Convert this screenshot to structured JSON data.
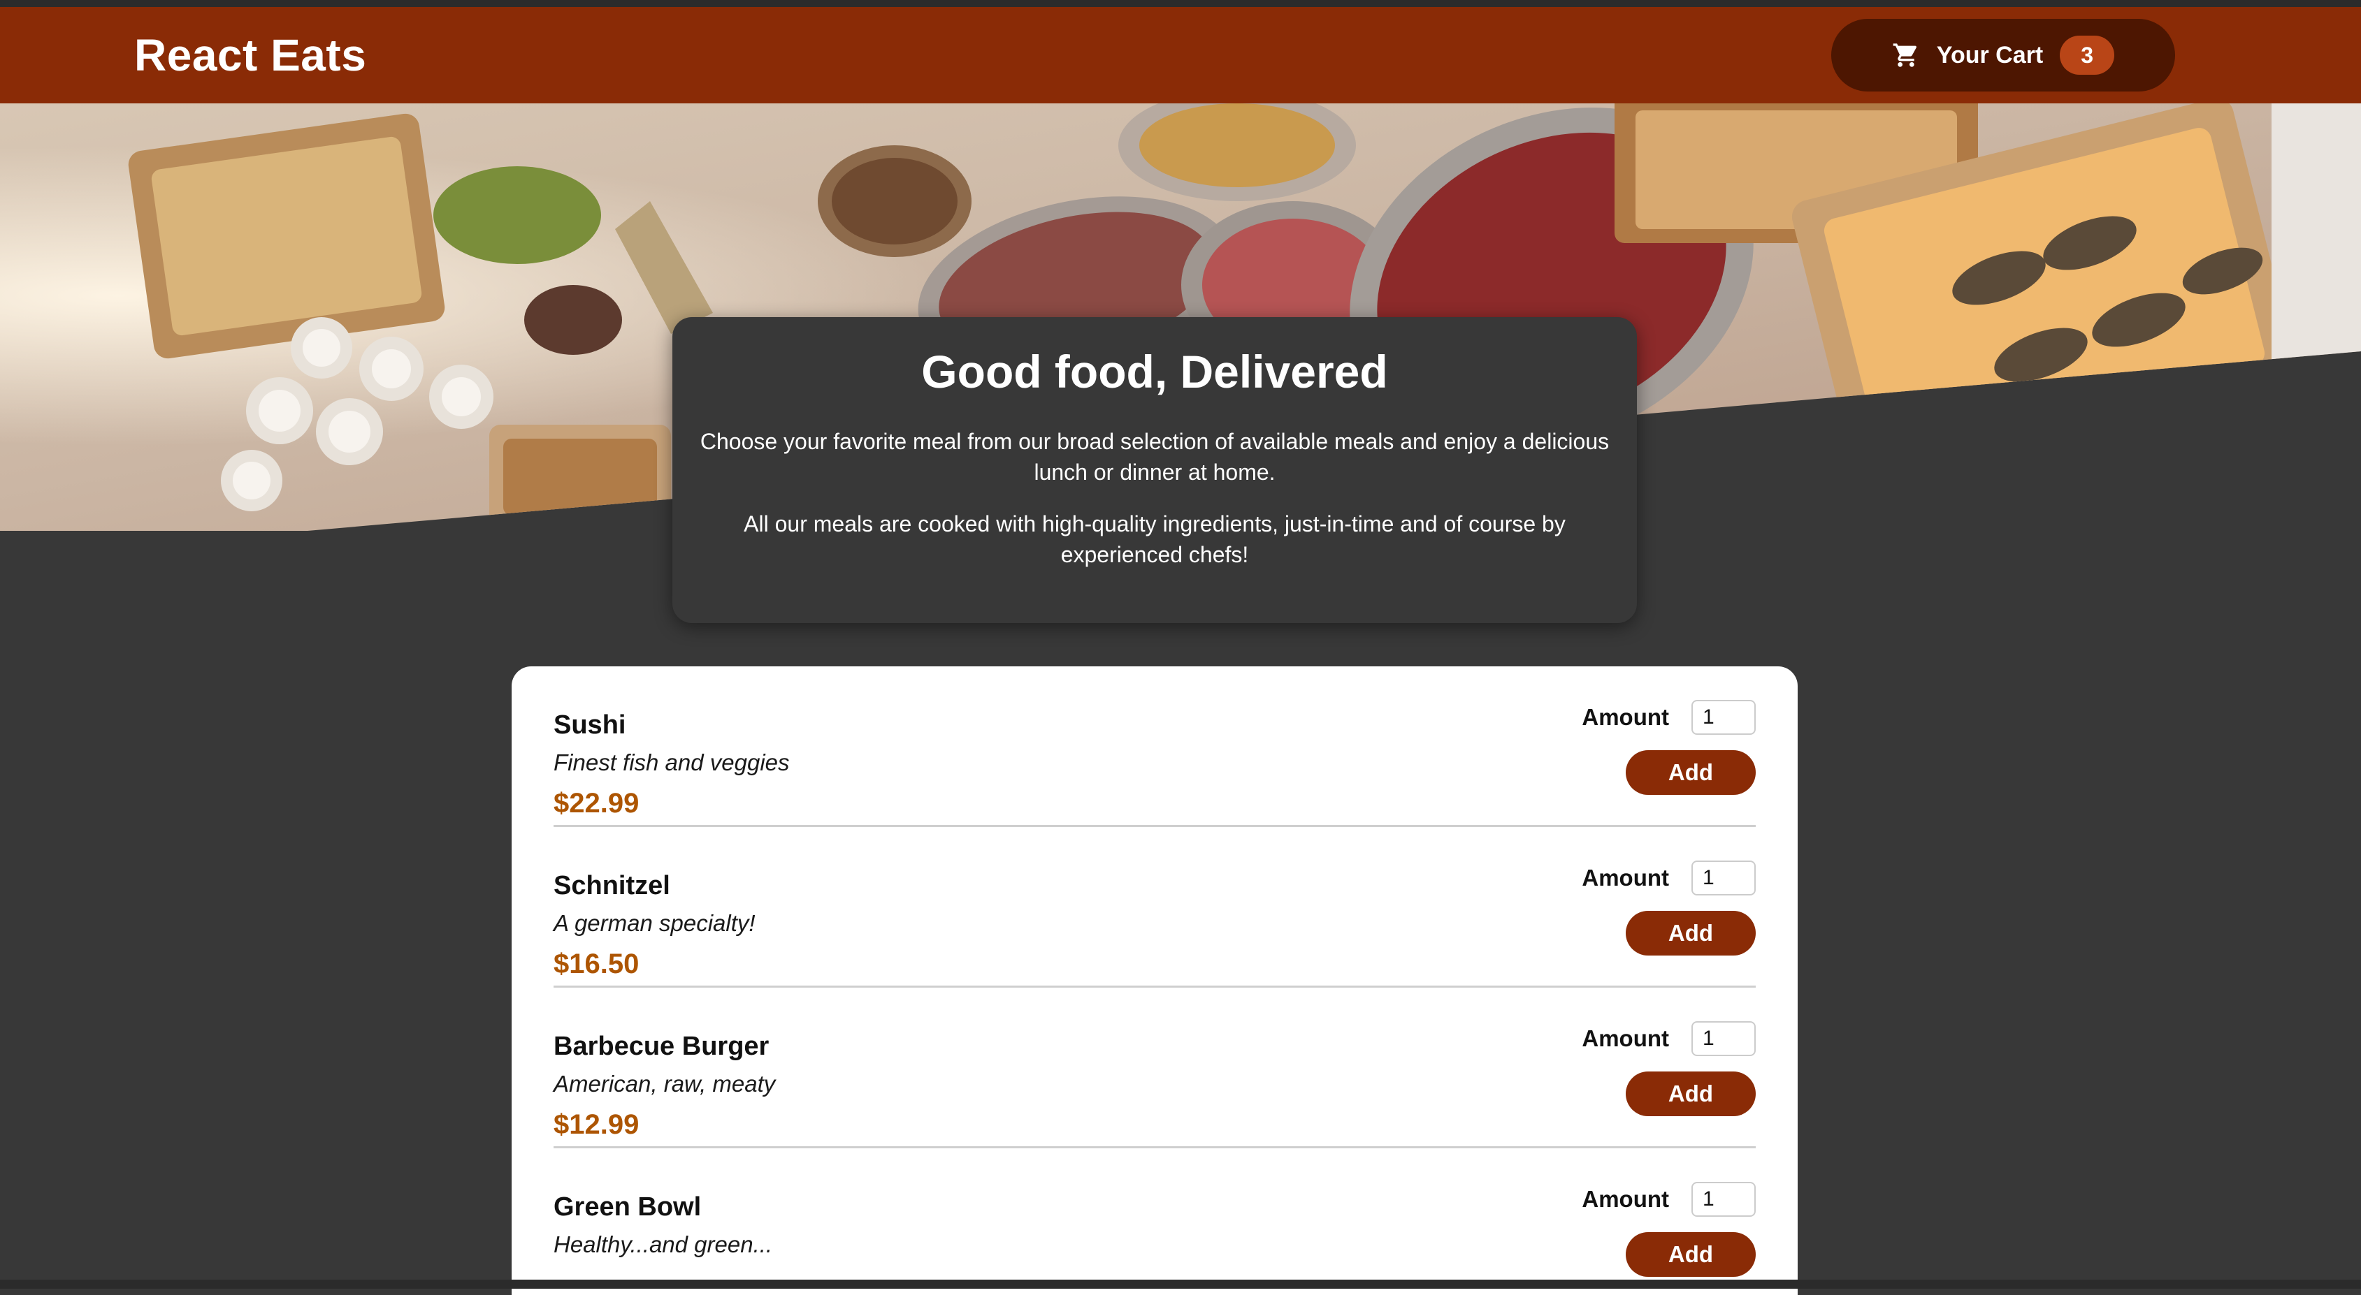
{
  "header": {
    "title": "React Eats",
    "cart_label": "Your Cart",
    "cart_count": "3",
    "cart_icon": "shopping-cart-icon"
  },
  "hero": {
    "image": "buffet-food-table-photo"
  },
  "summary": {
    "heading": "Good food, Delivered",
    "paragraph1": "Choose your favorite meal from our broad selection of available meals and enjoy a delicious lunch or dinner at home.",
    "paragraph2": "All our meals are cooked with high-quality ingredients, just-in-time and of course by experienced chefs!"
  },
  "meals": [
    {
      "name": "Sushi",
      "description": "Finest fish and veggies",
      "price": "$22.99",
      "amount_label": "Amount",
      "amount": "1",
      "add_label": "Add"
    },
    {
      "name": "Schnitzel",
      "description": "A german specialty!",
      "price": "$16.50",
      "amount_label": "Amount",
      "amount": "1",
      "add_label": "Add"
    },
    {
      "name": "Barbecue Burger",
      "description": "American, raw, meaty",
      "price": "$12.99",
      "amount_label": "Amount",
      "amount": "1",
      "add_label": "Add"
    },
    {
      "name": "Green Bowl",
      "description": "Healthy...and green...",
      "price": "",
      "amount_label": "Amount",
      "amount": "1",
      "add_label": "Add"
    }
  ],
  "colors": {
    "header": "#8a2b06",
    "cart_button": "#4d1601",
    "badge": "#b94517",
    "background": "#383838",
    "price": "#ad5502",
    "add_button": "#8a2b06"
  }
}
